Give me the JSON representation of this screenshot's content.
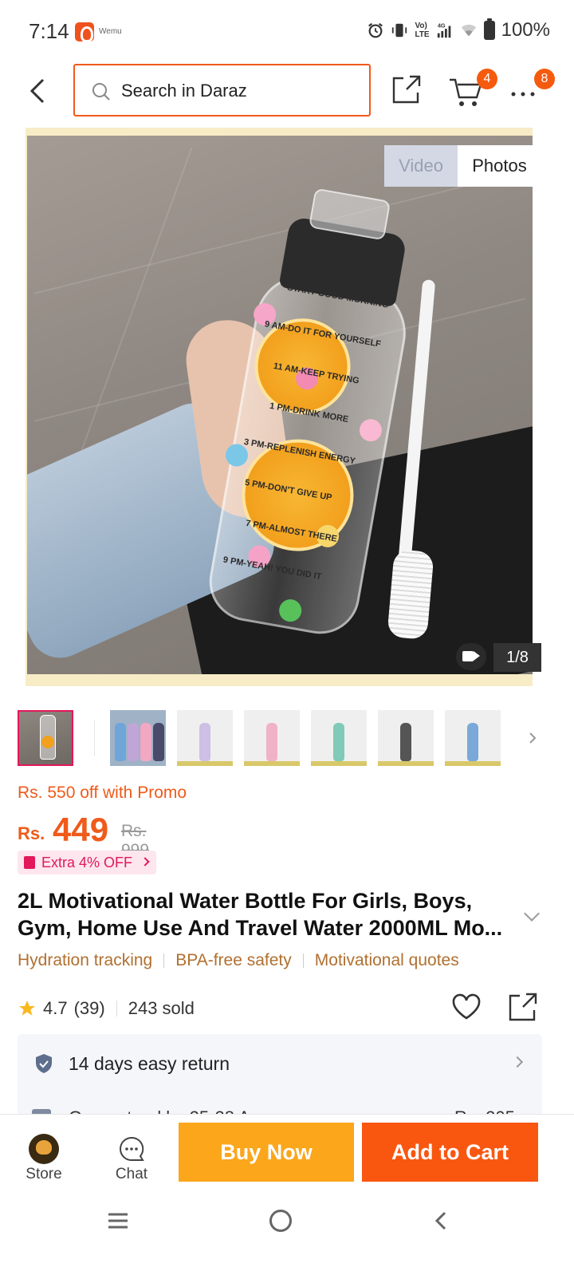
{
  "status_bar": {
    "time": "7:14",
    "small_app_label": "Wemu",
    "network_label_1": "Vo)",
    "network_label_2": "LTE",
    "network_type": "4G",
    "battery": "100%"
  },
  "top_nav": {
    "search_placeholder": "Search in Daraz",
    "cart_count": "4",
    "more_count": "8"
  },
  "gallery": {
    "toggle_video": "Video",
    "toggle_photos": "Photos",
    "counter": "1/8",
    "bottle_lines": [
      "START-GOOD MORNING",
      "9 AM-DO IT FOR YOURSELF",
      "11 AM-KEEP TRYING",
      "1 PM-DRINK MORE",
      "3 PM-REPLENISH ENERGY",
      "5 PM-DON'T GIVE UP",
      "7 PM-ALMOST THERE",
      "9 PM-YEAH! YOU DID IT"
    ]
  },
  "price": {
    "promo": "Rs. 550 off with Promo",
    "currency": "Rs.",
    "current": "449",
    "original": "Rs. 999",
    "extra_off": "Extra 4% OFF"
  },
  "product": {
    "title": "2L Motivational Water Bottle For Girls, Boys, Gym, Home Use And Travel Water 2000ML Mo...",
    "tags": [
      "Hydration tracking",
      "BPA-free safety",
      "Motivational quotes"
    ],
    "rating": "4.7",
    "review_count": "(39)",
    "sold": "243 sold"
  },
  "service": {
    "return_policy": "14 days easy return",
    "partial_left": "Guaranteed by 25-28 A",
    "partial_right": "Rs. 205"
  },
  "bottom_bar": {
    "store_label": "Store",
    "chat_label": "Chat",
    "buy_now": "Buy Now",
    "add_to_cart": "Add to Cart"
  },
  "colors": {
    "brand_orange": "#f05a1a",
    "buy_now": "#fba61b",
    "add_to_cart": "#f95610",
    "promo_pink": "#e2185a"
  },
  "icons": {
    "back": "back-arrow-icon",
    "search": "search-icon",
    "share": "share-icon",
    "cart": "cart-icon",
    "more": "more-dots-icon",
    "heart": "heart-icon",
    "star": "star-icon",
    "shield": "shield-icon",
    "chat": "chat-icon"
  }
}
